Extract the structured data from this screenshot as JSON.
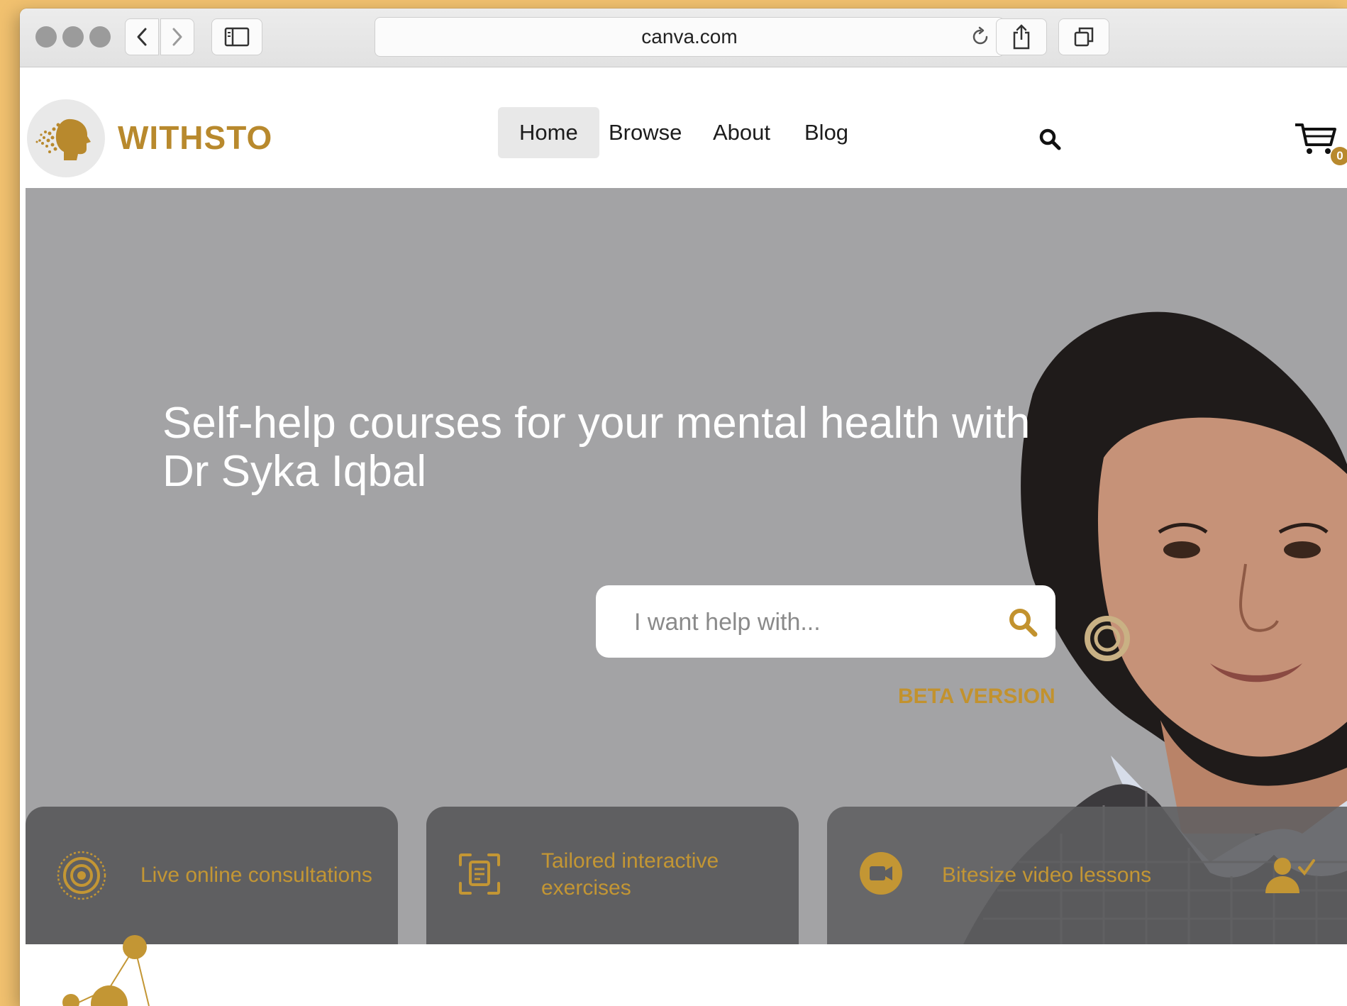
{
  "browser": {
    "url": "canva.com"
  },
  "site": {
    "brand": "WITHSTO",
    "nav": [
      {
        "label": "Home",
        "active": true
      },
      {
        "label": "Browse",
        "active": false
      },
      {
        "label": "About",
        "active": false
      },
      {
        "label": "Blog",
        "active": false
      }
    ],
    "cart_count": "0"
  },
  "hero": {
    "title_line1": "Self-help courses for your mental health with",
    "title_line2": "Dr Syka Iqbal",
    "search_placeholder": "I want help with...",
    "beta_label": "BETA VERSION"
  },
  "features": [
    {
      "label": "Live online consultations",
      "icon": "target-icon"
    },
    {
      "label_line1": "Tailored interactive",
      "label_line2": "exercises",
      "icon": "document-scan-icon"
    },
    {
      "label": "Bitesize video lessons",
      "icon": "video-camera-icon"
    }
  ],
  "colors": {
    "brand_gold": "#b8892d",
    "hero_gray": "#a3a3a5",
    "card_gray": "#5f5f61"
  }
}
